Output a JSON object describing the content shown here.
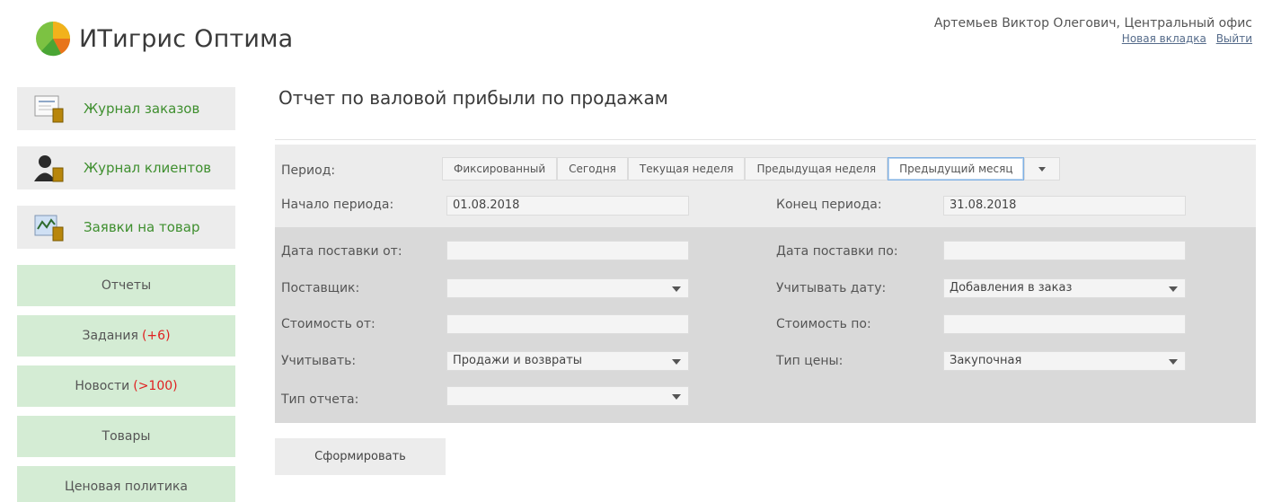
{
  "header": {
    "app_title": "ИТигрис Оптима",
    "user": "Артемьев Виктор Олегович, Центральный офис",
    "links": [
      "Новая вкладка",
      "Выйти"
    ]
  },
  "sidebar": {
    "big_items": [
      {
        "label": "Журнал заказов",
        "icon": "order-journal-icon"
      },
      {
        "label": "Журнал клиентов",
        "icon": "client-journal-icon"
      },
      {
        "label": "Заявки на товар",
        "icon": "product-request-icon"
      }
    ],
    "small_items": [
      {
        "label": "Отчеты",
        "badge": ""
      },
      {
        "label": "Задания",
        "badge": "(+6)"
      },
      {
        "label": "Новости",
        "badge": "(>100)"
      },
      {
        "label": "Товары",
        "badge": ""
      },
      {
        "label": "Ценовая политика",
        "badge": ""
      }
    ]
  },
  "main": {
    "title": "Отчет по валовой прибыли по продажам",
    "period_label": "Период:",
    "period_tabs": [
      "Фиксированный",
      "Сегодня",
      "Текущая неделя",
      "Предыдущая неделя",
      "Предыдущий месяц"
    ],
    "period_active": "Предыдущий месяц",
    "fields": {
      "start_label": "Начало периода:",
      "start_value": "01.08.2018",
      "end_label": "Конец периода:",
      "end_value": "31.08.2018",
      "delivery_from_label": "Дата поставки от:",
      "delivery_from_value": "",
      "delivery_to_label": "Дата поставки по:",
      "delivery_to_value": "",
      "supplier_label": "Поставщик:",
      "supplier_value": "",
      "consider_date_label": "Учитывать дату:",
      "consider_date_value": "Добавления в заказ",
      "cost_from_label": "Стоимость от:",
      "cost_from_value": "",
      "cost_to_label": "Стоимость по:",
      "cost_to_value": "",
      "consider_label": "Учитывать:",
      "consider_value": "Продажи и возвраты",
      "price_type_label": "Тип цены:",
      "price_type_value": "Закупочная",
      "report_type_label": "Тип отчета:",
      "report_type_value": ""
    },
    "submit_label": "Сформировать"
  },
  "colors": {
    "accent_green": "#3f8f2f",
    "badge_red": "#e02020",
    "nav_small_bg": "#d4ecd4"
  }
}
